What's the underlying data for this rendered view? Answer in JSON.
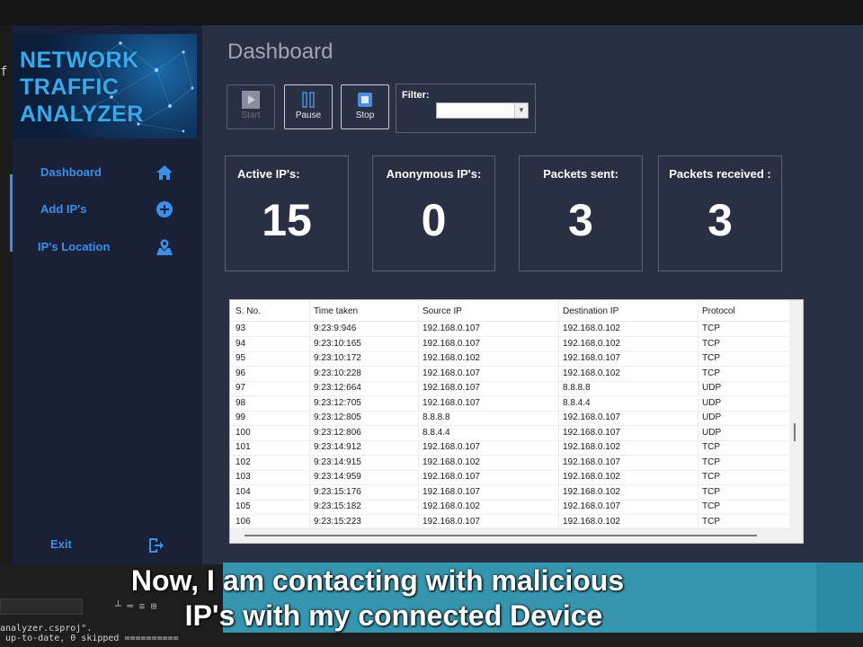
{
  "app": {
    "logo_text": "NETWORK\nTRAFFIC\nANALYZER",
    "ide_glyph": "f"
  },
  "sidebar": {
    "items": [
      {
        "label": "Dashboard",
        "icon": "home-icon"
      },
      {
        "label": "Add IP's",
        "icon": "plus-circle-icon"
      },
      {
        "label": "IP's Location",
        "icon": "map-pin-icon"
      }
    ],
    "exit_label": "Exit",
    "exit_icon": "exit-icon"
  },
  "main": {
    "title": "Dashboard",
    "toolbar": {
      "start_label": "Start",
      "pause_label": "Pause",
      "stop_label": "Stop",
      "filter_label": "Filter:",
      "filter_value": ""
    },
    "stats": [
      {
        "label": "Active IP's:",
        "value": "15"
      },
      {
        "label": "Anonymous IP's:",
        "value": "0"
      },
      {
        "label": "Packets sent:",
        "value": "3"
      },
      {
        "label": "Packets received :",
        "value": "3"
      }
    ],
    "table": {
      "columns": [
        "S. No.",
        "Time taken",
        "Source IP",
        "Destination IP",
        "Protocol"
      ],
      "rows": [
        [
          "93",
          "9:23:9:946",
          "192.168.0.107",
          "192.168.0.102",
          "TCP"
        ],
        [
          "94",
          "9:23:10:165",
          "192.168.0.107",
          "192.168.0.102",
          "TCP"
        ],
        [
          "95",
          "9:23:10:172",
          "192.168.0.102",
          "192.168.0.107",
          "TCP"
        ],
        [
          "96",
          "9:23:10:228",
          "192.168.0.107",
          "192.168.0.102",
          "TCP"
        ],
        [
          "97",
          "9:23:12:664",
          "192.168.0.107",
          "8.8.8.8",
          "UDP"
        ],
        [
          "98",
          "9:23:12:705",
          "192.168.0.107",
          "8.8.4.4",
          "UDP"
        ],
        [
          "99",
          "9:23:12:805",
          "8.8.8.8",
          "192.168.0.107",
          "UDP"
        ],
        [
          "100",
          "9:23:12:806",
          "8.8.4.4",
          "192.168.0.107",
          "UDP"
        ],
        [
          "101",
          "9:23:14:912",
          "192.168.0.107",
          "192.168.0.102",
          "TCP"
        ],
        [
          "102",
          "9:23:14:915",
          "192.168.0.102",
          "192.168.0.107",
          "TCP"
        ],
        [
          "103",
          "9:23:14:959",
          "192.168.0.107",
          "192.168.0.102",
          "TCP"
        ],
        [
          "104",
          "9:23:15:176",
          "192.168.0.107",
          "192.168.0.102",
          "TCP"
        ],
        [
          "105",
          "9:23:15:182",
          "192.168.0.102",
          "192.168.0.107",
          "TCP"
        ],
        [
          "106",
          "9:23:15:223",
          "192.168.0.107",
          "192.168.0.102",
          "TCP"
        ]
      ]
    }
  },
  "console": {
    "lines": [
      "analyzer.csproj\".",
      " up-to-date, 0 skipped =========="
    ]
  },
  "subtitle": {
    "line1": "Now, I am contacting with malicious",
    "line2": "IP's with my connected Device"
  },
  "colors": {
    "accent": "#3b8fe8",
    "sidebar_bg": "#1a2037",
    "main_bg": "#2a3044",
    "caption_bg": "#3aa3bf"
  }
}
